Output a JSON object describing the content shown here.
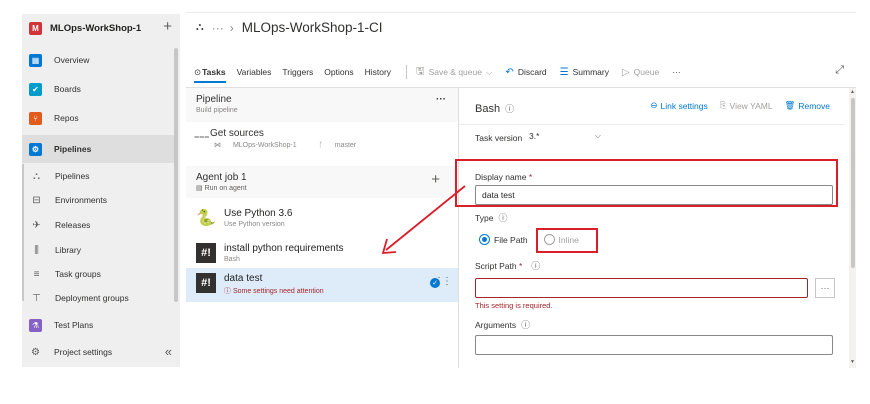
{
  "sidebar": {
    "org": {
      "badge": "M",
      "name": "MLOps-WorkShop-1",
      "plus": "+"
    },
    "items": [
      {
        "label": "Overview",
        "icon": "overview-icon",
        "color": "#0078d4",
        "glyph": "▦"
      },
      {
        "label": "Boards",
        "icon": "boards-icon",
        "color": "#009ccc",
        "glyph": "✔"
      },
      {
        "label": "Repos",
        "icon": "repos-icon",
        "color": "#e05b1c",
        "glyph": "⑂"
      },
      {
        "label": "Pipelines",
        "icon": "pipelines-icon",
        "color": "#0078d4",
        "glyph": "⚙"
      }
    ],
    "sub_items": [
      {
        "label": "Pipelines",
        "icon": "pipelines-sub-icon",
        "glyph": "⛬"
      },
      {
        "label": "Environments",
        "icon": "environments-icon",
        "glyph": "⊟"
      },
      {
        "label": "Releases",
        "icon": "releases-icon",
        "glyph": "✈"
      },
      {
        "label": "Library",
        "icon": "library-icon",
        "glyph": "⫼"
      },
      {
        "label": "Task groups",
        "icon": "task-groups-icon",
        "glyph": "≡"
      },
      {
        "label": "Deployment groups",
        "icon": "deployment-groups-icon",
        "glyph": "⊤"
      }
    ],
    "bottom_items": [
      {
        "label": "Test Plans",
        "icon": "test-plans-icon",
        "color": "#8661c5",
        "glyph": "⚗"
      },
      {
        "label": "Project settings",
        "icon": "settings-icon",
        "glyph": "⚙"
      }
    ],
    "collapse": "«"
  },
  "header": {
    "breadcrumb_more": "···",
    "breadcrumb_sep": "›",
    "title": "MLOps-WorkShop-1-CI"
  },
  "toolbar": {
    "tasks_icon": "⊙",
    "tabs": [
      "Tasks",
      "Variables",
      "Triggers",
      "Options",
      "History"
    ],
    "save_queue": "Save & queue",
    "discard": "Discard",
    "summary": "Summary",
    "queue": "Queue",
    "more": "···"
  },
  "pipeline": {
    "title": "Pipeline",
    "subtitle": "Build pipeline",
    "more": "···"
  },
  "get_sources": {
    "title": "Get sources",
    "repo": "MLOps-WorkShop-1",
    "branch": "master"
  },
  "agent_job": {
    "title": "Agent job 1",
    "subtitle": "Run on agent"
  },
  "tasks": [
    {
      "name": "Use Python 3.6",
      "subtitle": "Use Python version",
      "icon": "python-icon"
    },
    {
      "name": "install python requirements",
      "subtitle": "Bash",
      "icon": "bash-icon"
    },
    {
      "name": "data test",
      "subtitle": "Some settings need attention",
      "icon": "bash-icon"
    }
  ],
  "details": {
    "title": "Bash",
    "link_settings": "Link settings",
    "view_yaml": "View YAML",
    "remove": "Remove",
    "task_version_label": "Task version",
    "task_version_value": "3.*",
    "display_name_label": "Display name",
    "display_name_value": "data test",
    "type_label": "Type",
    "type_options": [
      "File Path",
      "Inline"
    ],
    "type_selected": "File Path",
    "script_path_label": "Script Path",
    "script_path_value": "",
    "required_error": "This setting is required.",
    "arguments_label": "Arguments",
    "arguments_value": "",
    "browse": "···",
    "required_mark": "*"
  },
  "colors": {
    "accent": "#0078d4",
    "error": "#a4262c",
    "annotation": "#d91f2a"
  }
}
